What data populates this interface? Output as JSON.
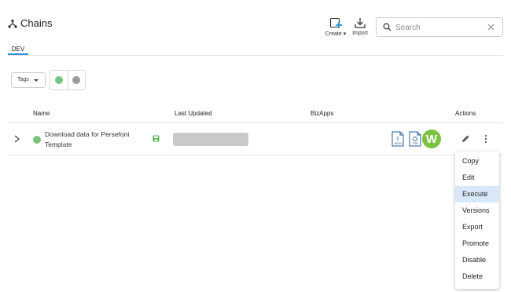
{
  "header": {
    "title": "Chains",
    "title_icon": "chains-icon",
    "create_label": "Create",
    "import_label": "Import"
  },
  "search": {
    "placeholder": "Search",
    "value": ""
  },
  "tabs": [
    {
      "label": "DEV",
      "active": true
    }
  ],
  "filters": {
    "tags_label": "Tags",
    "status_options": [
      {
        "name": "active",
        "color": "#7bc47f"
      },
      {
        "name": "inactive",
        "color": "#9a9a9a"
      }
    ]
  },
  "table": {
    "columns": [
      "Name",
      "Last Updated",
      "BizApps",
      "Actions"
    ],
    "rows": [
      {
        "name": "Download data for Persefoni Template",
        "status_color": "#7bc47f",
        "bizapps": [
          {
            "icon": "json-file-icon",
            "label": "JSON"
          },
          {
            "icon": "tsb-file-icon",
            "label": "TSB"
          },
          {
            "icon": "w-app-logo",
            "label": "W"
          }
        ]
      }
    ]
  },
  "action_menu": {
    "items": [
      "Copy",
      "Edit",
      "Execute",
      "Versions",
      "Export",
      "Promote",
      "Disable",
      "Delete"
    ],
    "highlighted": "Execute"
  },
  "colors": {
    "accent": "#2b8fd6",
    "active_status": "#7bc47f",
    "inactive_status": "#9a9a9a",
    "bizapp_brand": "#7bc142",
    "menu_highlight": "#d9e8f8"
  }
}
